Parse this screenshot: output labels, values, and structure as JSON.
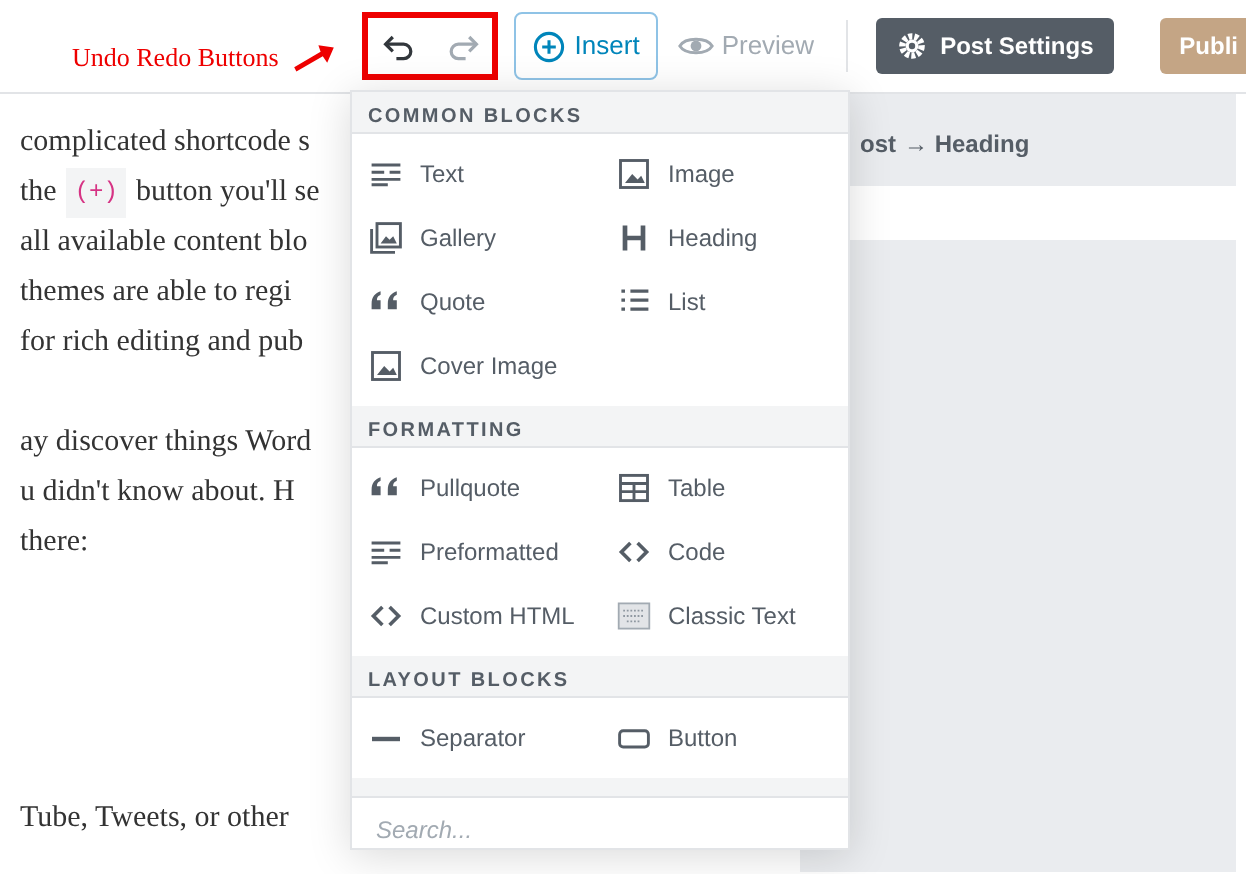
{
  "annotation": {
    "label": "Undo Redo Buttons"
  },
  "toolbar": {
    "undo": {
      "disabled": false
    },
    "redo": {
      "disabled": true
    },
    "insert": {
      "label": "Insert",
      "expanded": true
    },
    "preview": {
      "label": "Preview"
    },
    "post_settings": {
      "label": "Post Settings"
    },
    "publish": {
      "label": "Publi"
    }
  },
  "editor": {
    "paragraphs": [
      [
        [
          {
            "kind": "text",
            "text": "complicated shortcode s"
          }
        ],
        [
          {
            "kind": "text",
            "text": "the"
          },
          {
            "kind": "code",
            "text": "(+)"
          },
          {
            "kind": "text",
            "text": "button you'll se"
          }
        ],
        [
          {
            "kind": "text",
            "text": "all available content blo"
          }
        ],
        [
          {
            "kind": "text",
            "text": "themes are able to regi"
          }
        ],
        [
          {
            "kind": "text",
            "text": "for rich editing and pub"
          }
        ]
      ],
      [
        [
          {
            "kind": "text",
            "text": "ay discover things Word"
          }
        ],
        [
          {
            "kind": "text",
            "text": "u didn't know about. H"
          }
        ],
        [
          {
            "kind": "text",
            "text": "there:"
          }
        ]
      ],
      [
        [
          {
            "kind": "text",
            "text": "Tube, Tweets, or other"
          }
        ]
      ]
    ]
  },
  "sidebar": {
    "breadcrumb_link": "ost",
    "breadcrumb_current": "→ Heading"
  },
  "inserter": {
    "sections": [
      {
        "title": "COMMON BLOCKS",
        "blocks": [
          {
            "label": "Text",
            "kind": "text"
          },
          {
            "label": "Image",
            "kind": "image"
          },
          {
            "label": "Gallery",
            "kind": "gallery"
          },
          {
            "label": "Heading",
            "kind": "heading"
          },
          {
            "label": "Quote",
            "kind": "quote"
          },
          {
            "label": "List",
            "kind": "list"
          },
          {
            "label": "Cover Image",
            "kind": "image"
          }
        ]
      },
      {
        "title": "FORMATTING",
        "blocks": [
          {
            "label": "Pullquote",
            "kind": "quote"
          },
          {
            "label": "Table",
            "kind": "table"
          },
          {
            "label": "Preformatted",
            "kind": "text"
          },
          {
            "label": "Code",
            "kind": "code"
          },
          {
            "label": "Custom HTML",
            "kind": "code"
          },
          {
            "label": "Classic Text",
            "kind": "classic"
          }
        ]
      },
      {
        "title": "LAYOUT BLOCKS",
        "blocks": [
          {
            "label": "Separator",
            "kind": "separator"
          },
          {
            "label": "Button",
            "kind": "button"
          }
        ]
      }
    ],
    "search": {
      "placeholder": "Search..."
    }
  }
}
